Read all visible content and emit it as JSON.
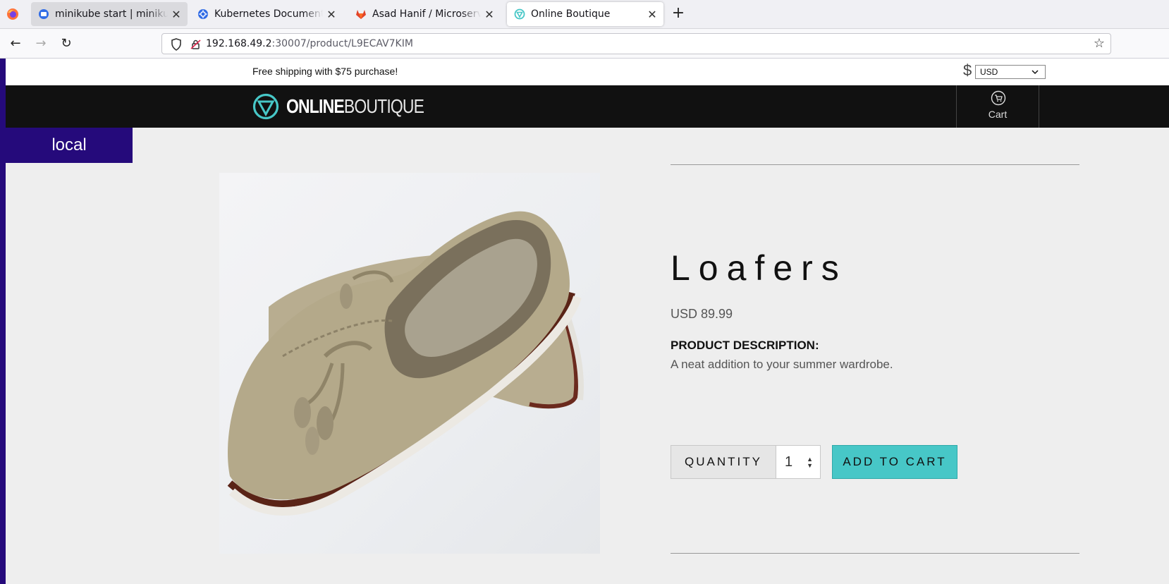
{
  "browser": {
    "tabs": [
      {
        "label": "minikube start | minikube",
        "icon": "minikube-favicon"
      },
      {
        "label": "Kubernetes Documentation",
        "icon": "kubernetes-favicon"
      },
      {
        "label": "Asad Hanif / Microservices",
        "icon": "gitlab-favicon"
      },
      {
        "label": "Online Boutique",
        "icon": "online-boutique-favicon"
      }
    ],
    "url_host": "192.168.49.2",
    "url_path": ":30007/product/L9ECAV7KIM"
  },
  "store": {
    "shipping_banner": "Free shipping with $75 purchase!",
    "currency_symbol": "$",
    "currency": "USD",
    "logo_bold": "ONLINE",
    "logo_light": "BOUTIQUE",
    "cart_label": "Cart",
    "env_badge": "local"
  },
  "product": {
    "name": "Loafers",
    "price": "USD 89.99",
    "description_heading": "PRODUCT DESCRIPTION:",
    "description": "A neat addition to your summer wardrobe.",
    "quantity_label": "QUANTITY",
    "quantity_value": "1",
    "add_to_cart_label": "ADD TO CART"
  },
  "colors": {
    "accent": "#47c7c7",
    "badge": "#250a7b",
    "header": "#111111"
  }
}
